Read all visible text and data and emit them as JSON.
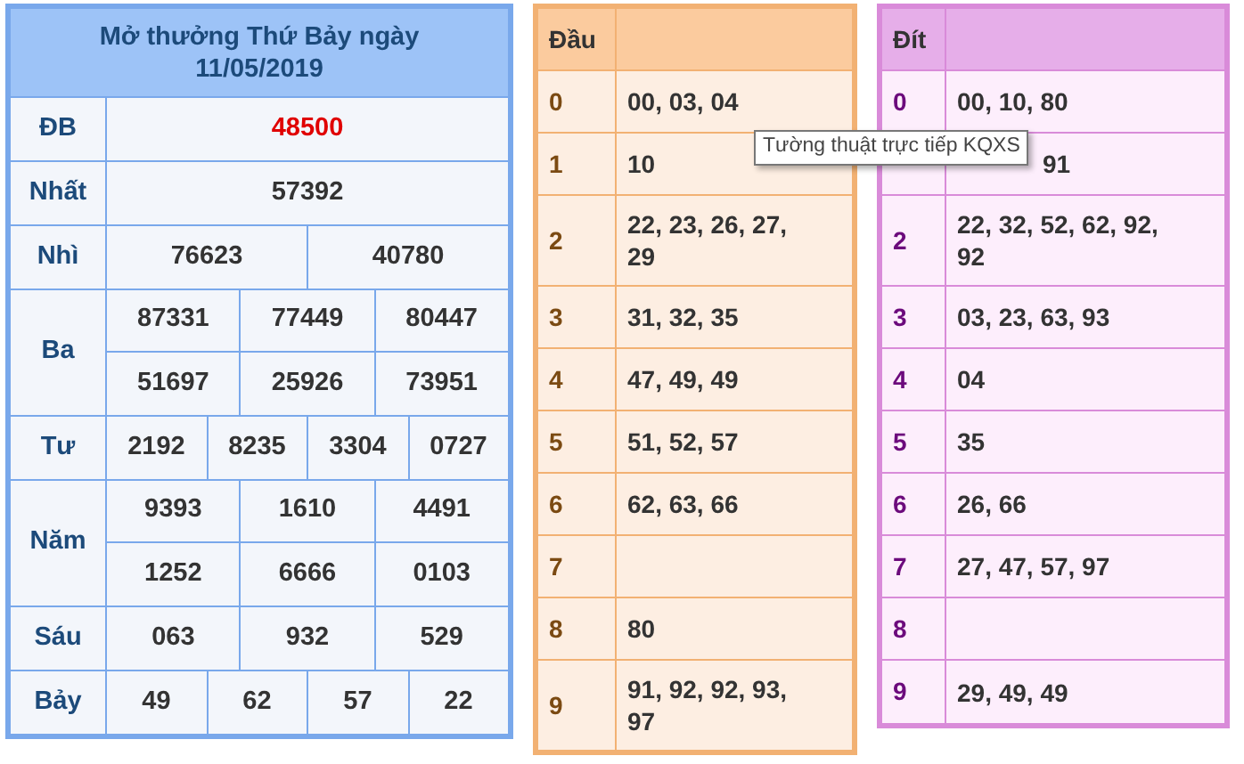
{
  "results": {
    "title": "Mở thưởng Thứ Bảy ngày",
    "date": "11/05/2019",
    "prizes": [
      {
        "name": "ĐB",
        "kind": "special",
        "rows": [
          [
            "48500"
          ]
        ]
      },
      {
        "name": "Nhất",
        "kind": "normal",
        "rows": [
          [
            "57392"
          ]
        ]
      },
      {
        "name": "Nhì",
        "kind": "normal",
        "rows": [
          [
            "76623",
            "40780"
          ]
        ]
      },
      {
        "name": "Ba",
        "kind": "normal",
        "rows": [
          [
            "87331",
            "77449",
            "80447"
          ],
          [
            "51697",
            "25926",
            "73951"
          ]
        ]
      },
      {
        "name": "Tư",
        "kind": "normal",
        "rows": [
          [
            "2192",
            "8235",
            "3304",
            "0727"
          ]
        ]
      },
      {
        "name": "Năm",
        "kind": "normal",
        "rows": [
          [
            "9393",
            "1610",
            "4491"
          ],
          [
            "1252",
            "6666",
            "0103"
          ]
        ]
      },
      {
        "name": "Sáu",
        "kind": "normal",
        "rows": [
          [
            "063",
            "932",
            "529"
          ]
        ]
      },
      {
        "name": "Bảy",
        "kind": "normal",
        "rows": [
          [
            "49",
            "62",
            "57",
            "22"
          ]
        ]
      }
    ]
  },
  "dau": {
    "header": "Đầu",
    "rows": [
      {
        "digit": "0",
        "numbers": "00, 03, 04"
      },
      {
        "digit": "1",
        "numbers": "10"
      },
      {
        "digit": "2",
        "numbers": "22, 23, 26, 27, 29"
      },
      {
        "digit": "3",
        "numbers": "31, 32, 35"
      },
      {
        "digit": "4",
        "numbers": "47, 49, 49"
      },
      {
        "digit": "5",
        "numbers": "51, 52, 57"
      },
      {
        "digit": "6",
        "numbers": "62, 63, 66"
      },
      {
        "digit": "7"
      },
      {
        "digit": "8",
        "numbers": "80"
      },
      {
        "digit": "9",
        "numbers": "91, 92, 92, 93, 97"
      }
    ]
  },
  "dit": {
    "header": "Đít",
    "rows": [
      {
        "digit": "0",
        "numbers": "00, 10, 80"
      },
      {
        "numbers": "91",
        "kind": "partly_hidden"
      },
      {
        "digit": "2",
        "numbers": "22, 32, 52, 62, 92, 92"
      },
      {
        "digit": "3",
        "numbers": "03, 23, 63, 93"
      },
      {
        "digit": "4",
        "numbers": "04"
      },
      {
        "digit": "5",
        "numbers": "35"
      },
      {
        "digit": "6",
        "numbers": "26, 66"
      },
      {
        "digit": "7",
        "numbers": "27, 47, 57, 97"
      },
      {
        "digit": "8"
      },
      {
        "digit": "9",
        "numbers": "29, 49, 49"
      }
    ]
  },
  "tooltip": "Tường thuật trực tiếp KQXS"
}
